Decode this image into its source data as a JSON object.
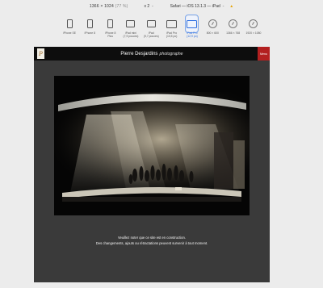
{
  "toolbar": {
    "dimensions": "1366 × 1024",
    "zoom": "(77 %)",
    "scale": "x 2",
    "user_agent": "Safari — iOS 13.1.3 — iPad",
    "chevron": "⌃"
  },
  "devices": [
    {
      "label": "iPhone SE",
      "kind": "phone"
    },
    {
      "label": "iPhone 8",
      "kind": "phone"
    },
    {
      "label": "iPhone 8\nPlus",
      "kind": "phone"
    },
    {
      "label": "iPad mini\n(7,9 pouces)",
      "kind": "tablet"
    },
    {
      "label": "iPad\n(9,7 pouces)",
      "kind": "tablet"
    },
    {
      "label": "iPad Pro\n(10,5 po)",
      "kind": "tablet"
    },
    {
      "label": "iPad Pro\n(12,9 po)",
      "kind": "tablet",
      "active": true
    },
    {
      "label": "800 × 600",
      "kind": "screen"
    },
    {
      "label": "1366 × 768",
      "kind": "screen"
    },
    {
      "label": "1920 × 1080",
      "kind": "screen"
    }
  ],
  "site": {
    "logo": "P",
    "name": "Pierre Desjardins",
    "subtitle": "photographe",
    "menu_label": "Menu",
    "notice_line1": "Veuillez noter que ce site est en construction.",
    "notice_line2": "Des changements, ajouts ou rétractations peuvent survenir à tout moment."
  },
  "colors": {
    "accent_active": "#2f6fe0",
    "menu_red": "#b32020",
    "site_background": "#3a3a3a"
  }
}
